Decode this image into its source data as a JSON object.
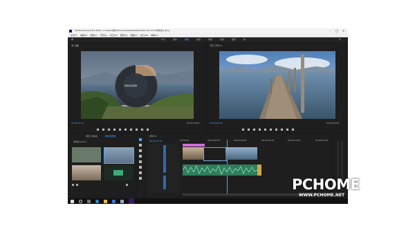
{
  "app": {
    "title": "Adobe Premiere Pro 2020 - C:\\Users\\用户\\Documents\\Adobe\\Premiere Pro\\14.0\\未命名.prproj",
    "menu": [
      "文件(F)",
      "编辑(E)",
      "剪辑(C)",
      "序列(S)",
      "标记(M)",
      "图形(G)",
      "视图(V)",
      "窗口(W)",
      "帮助(H)"
    ],
    "workspaces": [
      "学习",
      "组件",
      "编辑",
      "颜色",
      "效果",
      "音频",
      "图形",
      "库"
    ]
  },
  "source_monitor": {
    "tab": "源: 湖面",
    "timecode": "00:00:02:14",
    "duration": "00:00:10:00",
    "radial_menu_label": "帮助和选择器"
  },
  "program_monitor": {
    "tab": "节目: 序列 01",
    "timecode": "00:00:05:18",
    "duration": "00:00:24:00"
  },
  "project_panel": {
    "tabs": [
      "项目: 未命名",
      "媒体浏览器"
    ],
    "path": "未命名.prproj"
  },
  "timeline": {
    "tab": "序列 01",
    "timecode": "00:00:05:18",
    "ruler": [
      "00:00:00",
      "00:00:04:23",
      "00:00:09:23",
      "00:00:14:23",
      "00:00:19:23",
      "00:00:24:23"
    ]
  },
  "watermark": {
    "brand": "PCHOME",
    "url": "WWW.PCHOME.NET"
  },
  "colors": {
    "accent": "#4aa8ff",
    "video_clip": "#7ea7d8",
    "audio_clip": "#3fa97a",
    "title_clip": "#d36cd8"
  }
}
